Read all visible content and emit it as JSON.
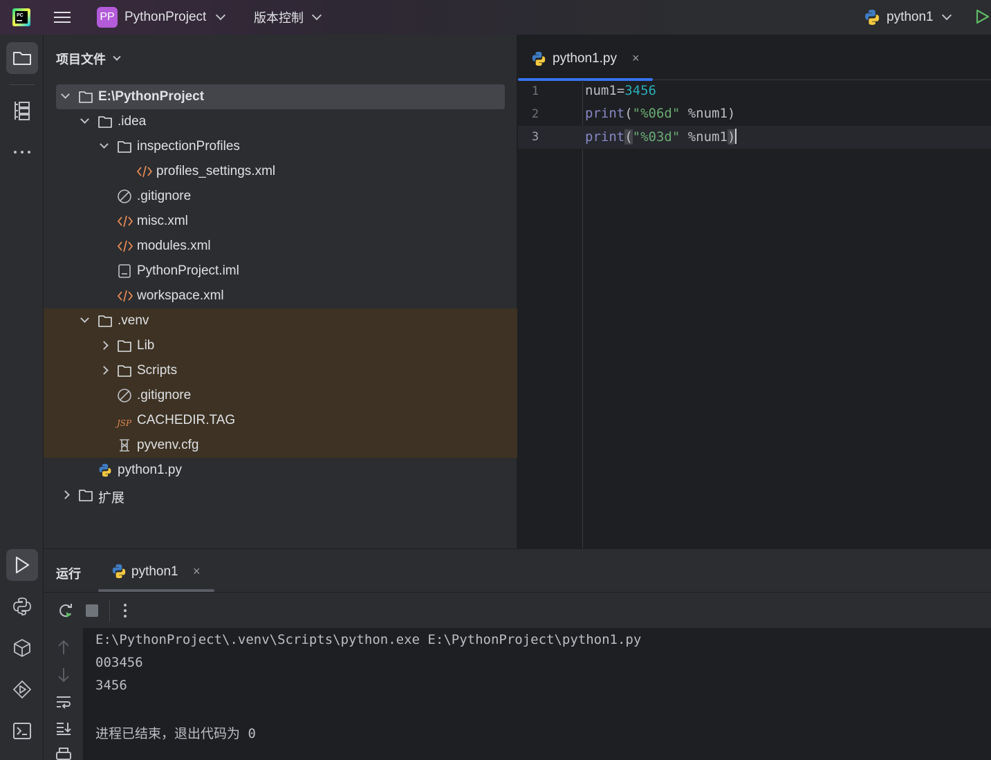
{
  "titlebar": {
    "project_badge": "PP",
    "project_name": "PythonProject",
    "vcs_label": "版本控制",
    "run_config": "python1"
  },
  "project_panel": {
    "title": "项目文件",
    "tree": [
      {
        "label": "E:\\PythonProject",
        "icon": "folder-icon",
        "expanded": true,
        "depth": 0
      },
      {
        "label": ".idea",
        "icon": "folder-icon",
        "expanded": true,
        "depth": 1
      },
      {
        "label": "inspectionProfiles",
        "icon": "folder-icon",
        "expanded": true,
        "depth": 2
      },
      {
        "label": "profiles_settings.xml",
        "icon": "xml-file-icon",
        "depth": 3
      },
      {
        "label": ".gitignore",
        "icon": "ignore-file-icon",
        "depth": 2
      },
      {
        "label": "misc.xml",
        "icon": "xml-file-icon",
        "depth": 2
      },
      {
        "label": "modules.xml",
        "icon": "xml-file-icon",
        "depth": 2
      },
      {
        "label": "PythonProject.iml",
        "icon": "iml-file-icon",
        "depth": 2
      },
      {
        "label": "workspace.xml",
        "icon": "xml-file-icon",
        "depth": 2
      },
      {
        "label": ".venv",
        "icon": "folder-icon",
        "expanded": true,
        "depth": 1
      },
      {
        "label": "Lib",
        "icon": "folder-icon",
        "expanded": false,
        "depth": 2
      },
      {
        "label": "Scripts",
        "icon": "folder-icon",
        "expanded": false,
        "depth": 2
      },
      {
        "label": ".gitignore",
        "icon": "ignore-file-icon",
        "depth": 2
      },
      {
        "label": "CACHEDIR.TAG",
        "icon": "jsp-file-icon",
        "depth": 2
      },
      {
        "label": "pyvenv.cfg",
        "icon": "cfg-file-icon",
        "depth": 2
      },
      {
        "label": "python1.py",
        "icon": "python-file-icon",
        "depth": 1
      },
      {
        "label": "扩展",
        "icon": "folder-icon",
        "expanded": false,
        "depth": 0
      }
    ],
    "jsp_glyph": "JSP"
  },
  "editor": {
    "tab_label": "python1.py",
    "tab_close": "×",
    "lines": [
      {
        "num": "1",
        "tokens": [
          [
            "plain",
            "num1="
          ],
          [
            "num",
            "3456"
          ]
        ]
      },
      {
        "num": "2",
        "tokens": [
          [
            "fn",
            "print"
          ],
          [
            "plain",
            "("
          ],
          [
            "str",
            "\"%06d\""
          ],
          [
            "plain",
            " %num1)"
          ]
        ]
      },
      {
        "num": "3",
        "tokens": [
          [
            "fn",
            "print"
          ],
          [
            "brace",
            "("
          ],
          [
            "str",
            "\"%03d\""
          ],
          [
            "plain",
            " %num1"
          ],
          [
            "brace",
            ")"
          ]
        ]
      }
    ]
  },
  "run_panel": {
    "title": "运行",
    "tab_label": "python1",
    "tab_close": "×",
    "console": [
      "E:\\PythonProject\\.venv\\Scripts\\python.exe E:\\PythonProject\\python1.py",
      "003456",
      "3456",
      "",
      "进程已结束，退出代码为 0"
    ]
  },
  "colors": {
    "accent": "#3574f0",
    "excluded_bg": "#3d3223",
    "string": "#6aab73",
    "number": "#2aacb8",
    "builtin": "#8888c6"
  }
}
